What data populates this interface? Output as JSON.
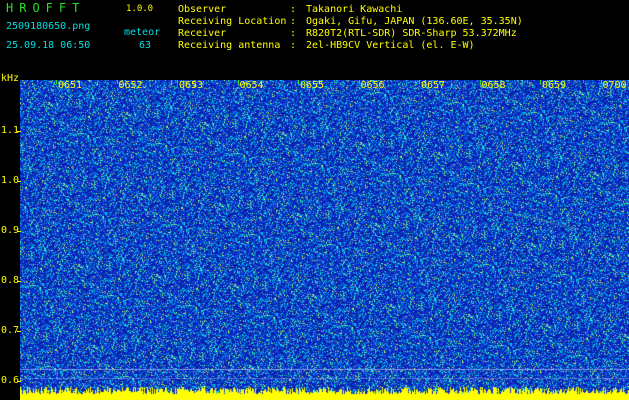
{
  "app": {
    "title": "HROFFT",
    "version": "1.0.0"
  },
  "file": {
    "name": "2509180650.png",
    "timestamp": "25.09.18 06:50"
  },
  "event": {
    "label": "meteor",
    "count": "63"
  },
  "info": [
    {
      "label": "Observer",
      "value": "Takanori Kawachi"
    },
    {
      "label": "Receiving Location",
      "value": "Ogaki, Gifu, JAPAN (136.60E, 35.35N)"
    },
    {
      "label": "Receiver",
      "value": "R820T2(RTL-SDR) SDR-Sharp 53.372MHz"
    },
    {
      "label": "Receiving antenna",
      "value": "2el-HB9CV Vertical (el. E-W)"
    }
  ],
  "spectrogram": {
    "y_unit": "kHz",
    "y_ticks": [
      "1.1",
      "1.0",
      "0.9",
      "0.8",
      "0.7",
      "0.6"
    ],
    "x_ticks": [
      "0651",
      "0652",
      "0653",
      "0654",
      "0655",
      "0656",
      "0657",
      "0658",
      "0659",
      "0700"
    ],
    "colors": {
      "background": "#1a2aa8",
      "noise_low": "#1030d0",
      "noise_mid": "#00c0e0",
      "noise_high": "#c0ff40",
      "carrier": "#ffff00",
      "label": "#ffff00",
      "marker": "#28e028"
    }
  }
}
